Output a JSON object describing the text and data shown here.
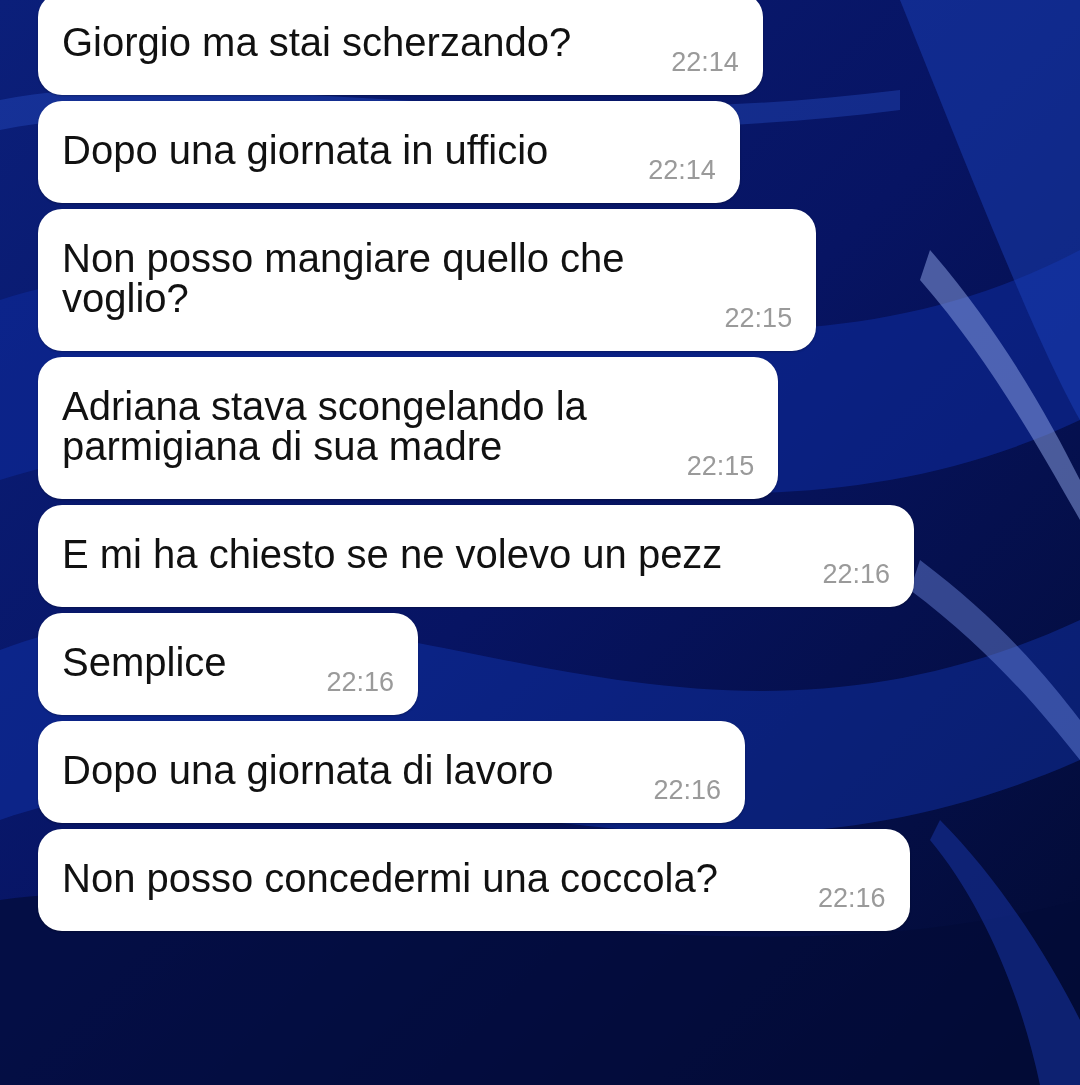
{
  "messages": [
    {
      "lines": [
        "Giorgio ma stai scherzando?"
      ],
      "time": "22:14"
    },
    {
      "lines": [
        "Dopo una giornata in ufficio"
      ],
      "time": "22:14"
    },
    {
      "lines": [
        "Non posso mangiare quello che",
        "voglio?"
      ],
      "time": "22:15"
    },
    {
      "lines": [
        "Adriana stava scongelando la",
        "parmigiana di sua madre"
      ],
      "time": "22:15"
    },
    {
      "lines": [
        "E mi ha chiesto se ne volevo un pezz"
      ],
      "time": "22:16"
    },
    {
      "lines": [
        "Semplice"
      ],
      "time": "22:16"
    },
    {
      "lines": [
        "Dopo una giornata di lavoro"
      ],
      "time": "22:16"
    },
    {
      "lines": [
        "Non posso concedermi una coccola?"
      ],
      "time": "22:16"
    }
  ]
}
